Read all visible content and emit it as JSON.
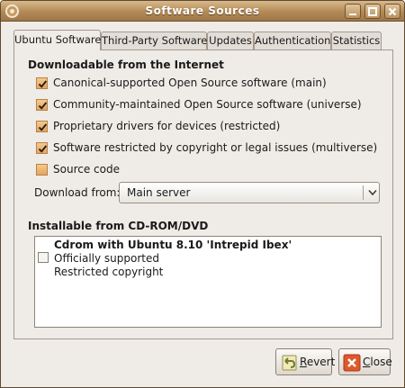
{
  "window": {
    "title": "Software Sources"
  },
  "tabs": [
    {
      "label": "Ubuntu Software",
      "active": true
    },
    {
      "label": "Third-Party Software",
      "active": false
    },
    {
      "label": "Updates",
      "active": false
    },
    {
      "label": "Authentication",
      "active": false
    },
    {
      "label": "Statistics",
      "active": false
    }
  ],
  "downloadable": {
    "heading": "Downloadable from the Internet",
    "components": [
      {
        "label": "Canonical-supported Open Source software (main)",
        "checked": true
      },
      {
        "label": "Community-maintained Open Source software (universe)",
        "checked": true
      },
      {
        "label": "Proprietary drivers for devices (restricted)",
        "checked": true
      },
      {
        "label": "Software restricted by copyright or legal issues (multiverse)",
        "checked": true
      },
      {
        "label": "Source code",
        "checked": false
      }
    ],
    "download_from_label": "Download from:",
    "download_from_value": "Main server"
  },
  "installable": {
    "heading": "Installable from CD-ROM/DVD",
    "cdrom": {
      "checked": false,
      "title": "Cdrom with Ubuntu 8.10 'Intrepid Ibex'",
      "lines": [
        "Officially supported",
        "Restricted copyright"
      ]
    }
  },
  "buttons": {
    "revert_mnemonic": "R",
    "revert_rest": "evert",
    "close_mnemonic": "C",
    "close_rest": "lose"
  },
  "colors": {
    "titlebar": "#b38a56",
    "checkbox_fill": "#e9a760",
    "window_bg": "#efebe7"
  },
  "icons": {
    "app": "software-sources-icon",
    "minimize": "minimize-icon",
    "maximize": "maximize-icon",
    "close": "close-icon",
    "combo_arrow": "chevron-down-icon",
    "revert": "revert-icon",
    "close_button": "close-x-icon"
  }
}
